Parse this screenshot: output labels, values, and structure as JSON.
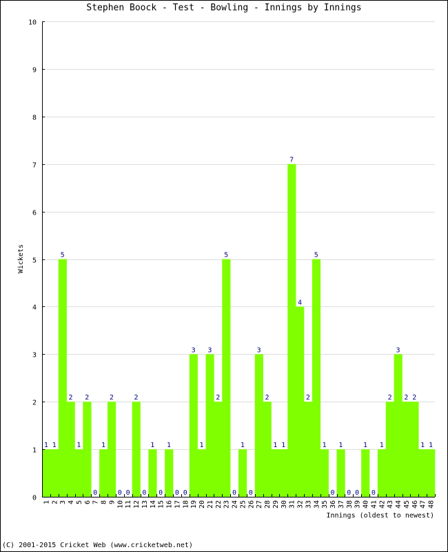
{
  "chart_data": {
    "type": "bar",
    "title": "Stephen Boock - Test - Bowling - Innings by Innings",
    "xlabel": "Innings (oldest to newest)",
    "ylabel": "Wickets",
    "ylim": [
      0,
      10
    ],
    "yticks": [
      0,
      1,
      2,
      3,
      4,
      5,
      6,
      7,
      8,
      9,
      10
    ],
    "grid": true,
    "legend": "none",
    "bar_color": "#80ff00",
    "label_color": "#000080",
    "grid_color": "#dddddd",
    "categories": [
      "1",
      "2",
      "3",
      "4",
      "5",
      "6",
      "7",
      "8",
      "9",
      "10",
      "11",
      "12",
      "13",
      "14",
      "15",
      "16",
      "17",
      "18",
      "19",
      "20",
      "21",
      "22",
      "23",
      "24",
      "25",
      "26",
      "27",
      "28",
      "29",
      "30",
      "31",
      "32",
      "33",
      "34",
      "35",
      "36",
      "37",
      "38",
      "39",
      "40",
      "41",
      "42",
      "43",
      "44",
      "45",
      "46",
      "47",
      "48"
    ],
    "values": [
      1,
      1,
      5,
      2,
      1,
      2,
      0,
      1,
      2,
      0,
      0,
      2,
      0,
      1,
      0,
      1,
      0,
      0,
      3,
      1,
      3,
      2,
      5,
      0,
      1,
      0,
      3,
      2,
      1,
      1,
      7,
      4,
      2,
      5,
      1,
      0,
      1,
      0,
      0,
      1,
      0,
      1,
      2,
      3,
      2,
      2,
      1,
      1
    ]
  },
  "footer": "(C) 2001-2015 Cricket Web (www.cricketweb.net)"
}
